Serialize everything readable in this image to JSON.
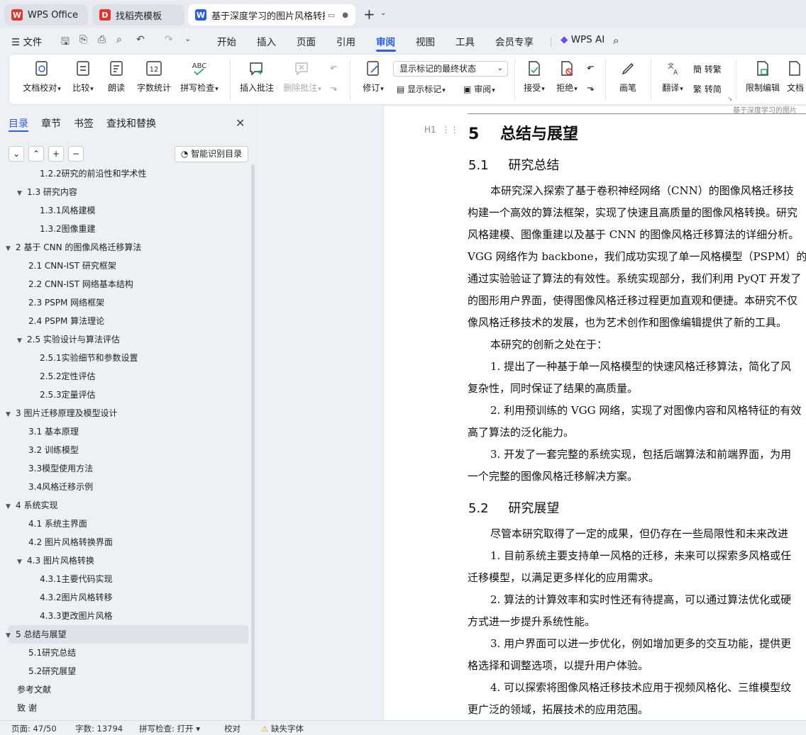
{
  "tabs": [
    {
      "label": "WPS Office"
    },
    {
      "label": "找稻壳模板"
    },
    {
      "label": "基于深度学习的图片风格转换"
    }
  ],
  "menu": {
    "file": "文件",
    "items": [
      "开始",
      "插入",
      "页面",
      "引用",
      "审阅",
      "视图",
      "工具",
      "会员专享"
    ],
    "active": "审阅",
    "ai": "WPS AI"
  },
  "ribbon": {
    "doc_proof": "文档校对",
    "compare": "比较",
    "read_aloud": "朗读",
    "word_count": "字数统计",
    "spell_check": "拼写检查",
    "insert_comment": "插入批注",
    "delete_comment": "删除批注",
    "revise": "修订",
    "markup_select": "显示标记的最终状态",
    "show_markup": "显示标记",
    "review": "审阅",
    "accept": "接受",
    "reject": "拒绝",
    "pen": "画笔",
    "translate": "翻译",
    "to_traditional": "转繁",
    "to_simplified": "转简",
    "restrict_edit": "限制编辑",
    "doc_rights": "文档"
  },
  "panel": {
    "tabs": [
      "目录",
      "章节",
      "书签",
      "查找和替换"
    ],
    "smart_toc": "智能识别目录",
    "toc": [
      {
        "t": "1.2.2研究的前沿性和学术性",
        "lvl": 3,
        "tri": ""
      },
      {
        "t": "1.3  研究内容",
        "lvl": 2,
        "tri": "▼"
      },
      {
        "t": "1.3.1风格建模",
        "lvl": 3,
        "tri": ""
      },
      {
        "t": "1.3.2图像重建",
        "lvl": 3,
        "tri": ""
      },
      {
        "t": "2  基于 CNN 的图像风格迁移算法",
        "lvl": 1,
        "tri": "▼"
      },
      {
        "t": "2.1  CNN-IST 研究框架",
        "lvl": 2,
        "tri": ""
      },
      {
        "t": "2.2  CNN-IST 网络基本结构",
        "lvl": 2,
        "tri": ""
      },
      {
        "t": "2.3  PSPM  网络框架",
        "lvl": 2,
        "tri": ""
      },
      {
        "t": "2.4  PSPM 算法理论",
        "lvl": 2,
        "tri": ""
      },
      {
        "t": "2.5  实验设计与算法评估",
        "lvl": 2,
        "tri": "▼"
      },
      {
        "t": "2.5.1实验细节和参数设置",
        "lvl": 3,
        "tri": ""
      },
      {
        "t": "2.5.2定性评估",
        "lvl": 3,
        "tri": ""
      },
      {
        "t": "2.5.3定量评估",
        "lvl": 3,
        "tri": ""
      },
      {
        "t": "3  图片迁移原理及模型设计",
        "lvl": 1,
        "tri": "▼"
      },
      {
        "t": "3.1  基本原理",
        "lvl": 2,
        "tri": ""
      },
      {
        "t": "3.2  训练模型",
        "lvl": 2,
        "tri": ""
      },
      {
        "t": "3.3模型使用方法",
        "lvl": 2,
        "tri": ""
      },
      {
        "t": "3.4风格迁移示例",
        "lvl": 2,
        "tri": ""
      },
      {
        "t": "4  系统实现",
        "lvl": 1,
        "tri": "▼"
      },
      {
        "t": "4.1  系统主界面",
        "lvl": 2,
        "tri": ""
      },
      {
        "t": "4.2  图片风格转换界面",
        "lvl": 2,
        "tri": ""
      },
      {
        "t": "4.3  图片风格转换",
        "lvl": 2,
        "tri": "▼"
      },
      {
        "t": "4.3.1主要代码实现",
        "lvl": 3,
        "tri": ""
      },
      {
        "t": "4.3.2图片风格转移",
        "lvl": 3,
        "tri": ""
      },
      {
        "t": "4.3.3更改图片风格",
        "lvl": 3,
        "tri": ""
      },
      {
        "t": "5  总结与展望",
        "lvl": 1,
        "tri": "▼",
        "sel": true
      },
      {
        "t": "5.1研究总结",
        "lvl": 2,
        "tri": ""
      },
      {
        "t": "5.2研究展望",
        "lvl": 2,
        "tri": ""
      },
      {
        "t": "参考文献",
        "lvl": 1,
        "tri": ""
      },
      {
        "t": "致    谢",
        "lvl": 1,
        "tri": ""
      }
    ]
  },
  "doc": {
    "header_text": "基于深度学习的图片",
    "h_marker": "H1",
    "h1_num": "5",
    "h1_title": "总结与展望",
    "s1_num": "5.1",
    "s1_title": "研究总结",
    "s2_num": "5.2",
    "s2_title": "研究展望",
    "lines": [
      "本研究深入探索了基于卷积神经网络（CNN）的图像风格迁移技",
      "构建一个高效的算法框架，实现了快速且高质量的图像风格转换。研究",
      "风格建模、图像重建以及基于 CNN 的图像风格迁移算法的详细分析。",
      "VGG 网络作为 backbone，我们成功实现了单一风格模型（PSPM）的实",
      "通过实验验证了算法的有效性。系统实现部分，我们利用 PyQT 开发了",
      "的图形用户界面，使得图像风格迁移过程更加直观和便捷。本研究不仅",
      "像风格迁移技术的发展，也为艺术创作和图像编辑提供了新的工具。",
      "本研究的创新之处在于：",
      "1. 提出了一种基于单一风格模型的快速风格迁移算法，简化了风",
      "复杂性，同时保证了结果的高质量。",
      "2. 利用预训练的 VGG 网络，实现了对图像内容和风格特征的有效",
      "高了算法的泛化能力。",
      "3. 开发了一套完整的系统实现，包括后端算法和前端界面，为用",
      "一个完整的图像风格迁移解决方案。"
    ],
    "lines2": [
      "尽管本研究取得了一定的成果，但仍存在一些局限性和未来改进",
      "1. 目前系统主要支持单一风格的迁移，未来可以探索多风格或任",
      "迁移模型，以满足更多样化的应用需求。",
      "2. 算法的计算效率和实时性还有待提高，可以通过算法优化或硬",
      "方式进一步提升系统性能。",
      "3. 用户界面可以进一步优化，例如增加更多的交互功能，提供更",
      "格选择和调整选项，以提升用户体验。",
      "4. 可以探索将图像风格迁移技术应用于视频风格化、三维模型纹",
      "更广泛的领域，拓展技术的应用范围。"
    ]
  },
  "status": {
    "page": "页面: 47/50",
    "words": "字数: 13794",
    "spell": "拼写检查: 打开",
    "proof": "校对",
    "missing_font": "缺失字体"
  }
}
